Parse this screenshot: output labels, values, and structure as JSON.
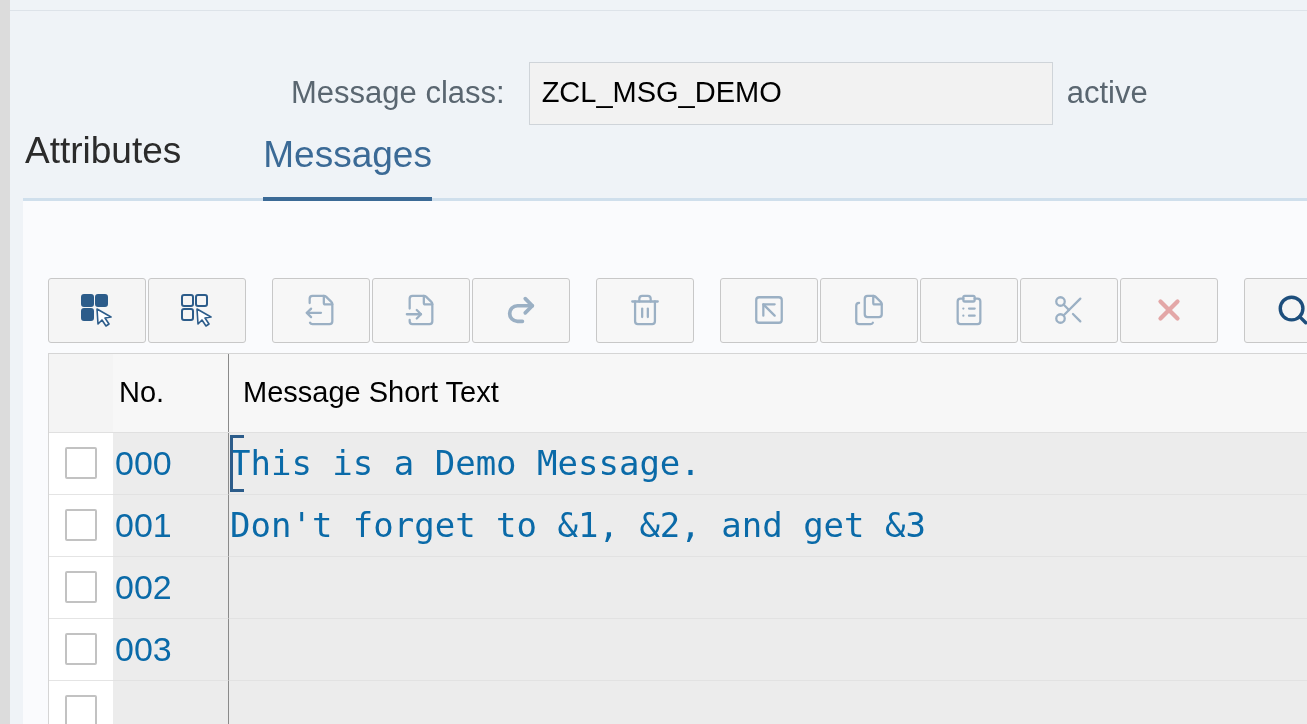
{
  "header": {
    "label": "Message class:",
    "value": "ZCL_MSG_DEMO",
    "status": "active"
  },
  "tabs": [
    {
      "label": "Attributes",
      "selected": false
    },
    {
      "label": "Messages",
      "selected": true
    }
  ],
  "toolbar": [
    [
      {
        "kind": "select-all",
        "disabled": false
      },
      {
        "kind": "deselect-all",
        "disabled": false
      }
    ],
    [
      {
        "kind": "doc-in",
        "disabled": true
      },
      {
        "kind": "doc-out",
        "disabled": true
      },
      {
        "kind": "redo",
        "disabled": true
      }
    ],
    [
      {
        "kind": "trash",
        "disabled": true
      }
    ],
    [
      {
        "kind": "jump",
        "disabled": true
      },
      {
        "kind": "copy",
        "disabled": true
      },
      {
        "kind": "paste",
        "disabled": true
      },
      {
        "kind": "cut",
        "disabled": true
      },
      {
        "kind": "cancel",
        "disabled": true
      }
    ],
    [
      {
        "kind": "search",
        "disabled": false
      }
    ]
  ],
  "table": {
    "columns": [
      "No.",
      "Message Short Text"
    ],
    "rows": [
      {
        "no": "000",
        "text": "This is a Demo Message.",
        "checked": false,
        "focused": true
      },
      {
        "no": "001",
        "text": "Don't forget to &1, &2, and get &3",
        "checked": false,
        "focused": false
      },
      {
        "no": "002",
        "checked": false,
        "focused": false
      },
      {
        "no": "003",
        "checked": false,
        "focused": false
      },
      {
        "checked": false,
        "focused": false
      }
    ]
  }
}
